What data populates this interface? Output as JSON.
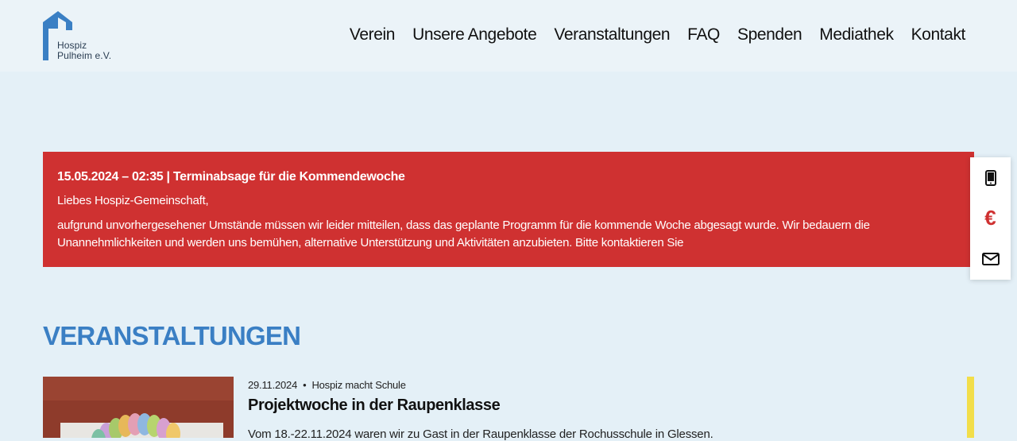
{
  "header": {
    "logo": {
      "line1": "Hospiz",
      "line2": "Pulheim e.V."
    },
    "nav": [
      "Verein",
      "Unsere Angebote",
      "Veranstaltungen",
      "FAQ",
      "Spenden",
      "Mediathek",
      "Kontakt"
    ]
  },
  "alert": {
    "title": "15.05.2024 – 02:35 | Terminabsage für die Kommendewoche",
    "greeting": "Liebes Hospiz-Gemeinschaft,",
    "body": "aufgrund unvorhergesehener Umstände müssen wir leider mitteilen, dass das geplante Programm für die kommende Woche abgesagt wurde. Wir bedauern die Unannehmlichkeiten und werden uns bemühen, alternative Unterstützung und Aktivitäten anzubieten. Bitte kontaktieren Sie"
  },
  "side_widget": {
    "icons": [
      "phone-icon",
      "euro-icon",
      "mail-icon"
    ],
    "euro_symbol": "€"
  },
  "events": {
    "heading": "VERANSTALTUNGEN",
    "items": [
      {
        "date": "29.11.2024",
        "separator": "•",
        "category": "Hospiz macht Schule",
        "title": "Projektwoche in der Raupenklasse",
        "excerpt": "Vom 18.-22.11.2024 waren wir zu Gast in der Raupenklasse der Rochusschule in Glessen."
      }
    ]
  },
  "colors": {
    "brand_blue": "#3a7fc4",
    "alert_red": "#cf3131",
    "accent_yellow": "#f2de4a",
    "page_bg": "#e4f0f7"
  }
}
